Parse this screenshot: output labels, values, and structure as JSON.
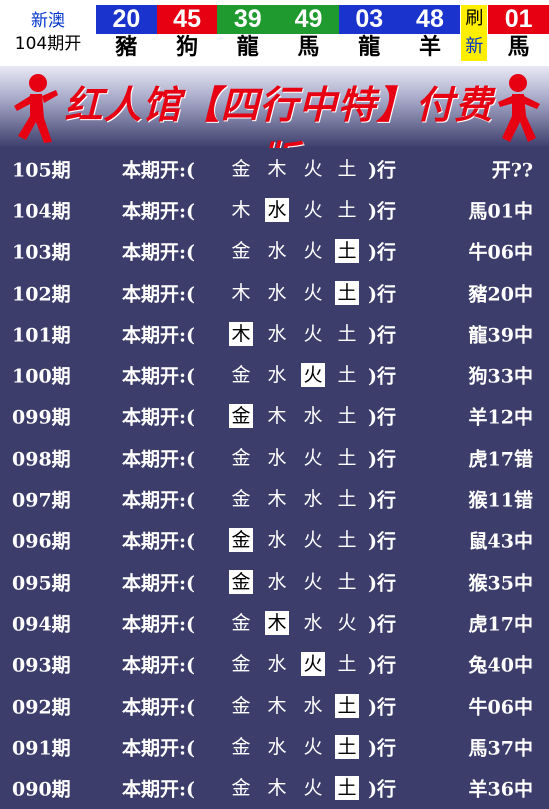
{
  "header": {
    "location": "新澳",
    "period": "104期开",
    "balls": [
      {
        "number": "20",
        "zodiac": "豬",
        "color": "#1a33cc"
      },
      {
        "number": "45",
        "zodiac": "狗",
        "color": "#e60012"
      },
      {
        "number": "39",
        "zodiac": "龍",
        "color": "#1f9a2e"
      },
      {
        "number": "49",
        "zodiac": "馬",
        "color": "#1f9a2e"
      },
      {
        "number": "03",
        "zodiac": "龍",
        "color": "#1a33cc"
      },
      {
        "number": "48",
        "zodiac": "羊",
        "color": "#1a33cc"
      }
    ],
    "refresh": [
      "刷",
      "新"
    ],
    "special": {
      "number": "01",
      "zodiac": "馬",
      "color": "#e60012"
    }
  },
  "banner": {
    "title": "红人馆【四行中特】付费版"
  },
  "rows": [
    {
      "period": "105期",
      "label": "本期开:(",
      "elements": [
        "金",
        "木",
        "火",
        "土"
      ],
      "highlight": -1,
      "close": ")行",
      "result": "开??"
    },
    {
      "period": "104期",
      "label": "本期开:(",
      "elements": [
        "木",
        "水",
        "火",
        "土"
      ],
      "highlight": 1,
      "close": ")行",
      "result": "馬01中"
    },
    {
      "period": "103期",
      "label": "本期开:(",
      "elements": [
        "金",
        "水",
        "火",
        "土"
      ],
      "highlight": 3,
      "close": ")行",
      "result": "牛06中"
    },
    {
      "period": "102期",
      "label": "本期开:(",
      "elements": [
        "木",
        "水",
        "火",
        "土"
      ],
      "highlight": 3,
      "close": ")行",
      "result": "豬20中"
    },
    {
      "period": "101期",
      "label": "本期开:(",
      "elements": [
        "木",
        "水",
        "火",
        "土"
      ],
      "highlight": 0,
      "close": ")行",
      "result": "龍39中"
    },
    {
      "period": "100期",
      "label": "本期开:(",
      "elements": [
        "金",
        "水",
        "火",
        "土"
      ],
      "highlight": 2,
      "close": ")行",
      "result": "狗33中"
    },
    {
      "period": "099期",
      "label": "本期开:(",
      "elements": [
        "金",
        "木",
        "水",
        "土"
      ],
      "highlight": 0,
      "close": ")行",
      "result": "羊12中"
    },
    {
      "period": "098期",
      "label": "本期开:(",
      "elements": [
        "金",
        "水",
        "火",
        "土"
      ],
      "highlight": -1,
      "close": ")行",
      "result": "虎17错"
    },
    {
      "period": "097期",
      "label": "本期开:(",
      "elements": [
        "金",
        "木",
        "水",
        "土"
      ],
      "highlight": -1,
      "close": ")行",
      "result": "猴11错"
    },
    {
      "period": "096期",
      "label": "本期开:(",
      "elements": [
        "金",
        "水",
        "火",
        "土"
      ],
      "highlight": 0,
      "close": ")行",
      "result": "鼠43中"
    },
    {
      "period": "095期",
      "label": "本期开:(",
      "elements": [
        "金",
        "水",
        "火",
        "土"
      ],
      "highlight": 0,
      "close": ")行",
      "result": "猴35中"
    },
    {
      "period": "094期",
      "label": "本期开:(",
      "elements": [
        "金",
        "木",
        "水",
        "火"
      ],
      "highlight": 1,
      "close": ")行",
      "result": "虎17中"
    },
    {
      "period": "093期",
      "label": "本期开:(",
      "elements": [
        "金",
        "水",
        "火",
        "土"
      ],
      "highlight": 2,
      "close": ")行",
      "result": "兔40中"
    },
    {
      "period": "092期",
      "label": "本期开:(",
      "elements": [
        "金",
        "木",
        "水",
        "土"
      ],
      "highlight": 3,
      "close": ")行",
      "result": "牛06中"
    },
    {
      "period": "091期",
      "label": "本期开:(",
      "elements": [
        "金",
        "水",
        "火",
        "土"
      ],
      "highlight": 3,
      "close": ")行",
      "result": "馬37中"
    },
    {
      "period": "090期",
      "label": "本期开:(",
      "elements": [
        "金",
        "木",
        "火",
        "土"
      ],
      "highlight": 3,
      "close": ")行",
      "result": "羊36中"
    }
  ]
}
